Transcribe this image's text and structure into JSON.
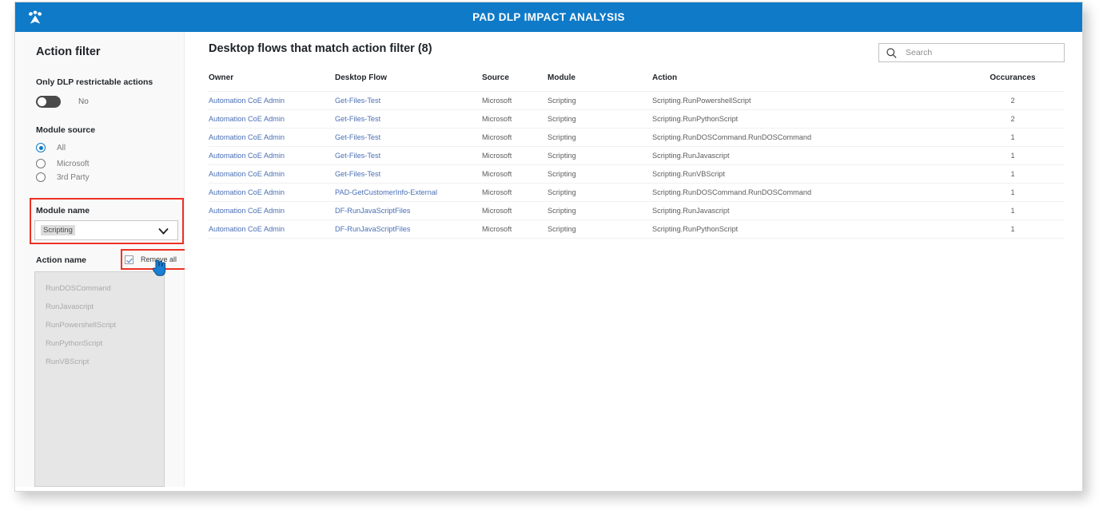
{
  "header": {
    "title": "PAD DLP IMPACT ANALYSIS",
    "logo_icon": "paw-print-icon",
    "background_color": "#0f7ac8"
  },
  "sidebar": {
    "title": "Action filter",
    "dlp_filter": {
      "label": "Only DLP restrictable actions",
      "toggle_value": "No",
      "toggle_on": false
    },
    "module_source": {
      "label": "Module source",
      "options": [
        {
          "label": "All",
          "selected": true
        },
        {
          "label": "Microsoft",
          "selected": false
        },
        {
          "label": "3rd Party",
          "selected": false
        }
      ]
    },
    "module_name": {
      "label": "Module name",
      "selected": "Scripting",
      "chevron_icon": "chevron-down-icon",
      "highlight_color": "#ee3124"
    },
    "action_name": {
      "label": "Action name",
      "remove_all_label": "Remove all",
      "remove_all_checked": true,
      "highlight_color": "#ee3124",
      "items": [
        "RunDOSCommand",
        "RunJavascript",
        "RunPowershellScript",
        "RunPythonScript",
        "RunVBScript"
      ]
    },
    "cursor_icon": "pointing-hand-cursor"
  },
  "main": {
    "title": "Desktop flows that match action filter (8)",
    "search": {
      "placeholder": "Search",
      "value": "",
      "icon": "search-icon"
    },
    "table": {
      "columns": [
        "Owner",
        "Desktop Flow",
        "Source",
        "Module",
        "Action",
        "Occurances"
      ],
      "rows": [
        {
          "owner": "Automation CoE Admin",
          "flow": "Get-Files-Test",
          "source": "Microsoft",
          "module": "Scripting",
          "action": "Scripting.RunPowershellScript",
          "occurances": "2"
        },
        {
          "owner": "Automation CoE Admin",
          "flow": "Get-Files-Test",
          "source": "Microsoft",
          "module": "Scripting",
          "action": "Scripting.RunPythonScript",
          "occurances": "2"
        },
        {
          "owner": "Automation CoE Admin",
          "flow": "Get-Files-Test",
          "source": "Microsoft",
          "module": "Scripting",
          "action": "Scripting.RunDOSCommand.RunDOSCommand",
          "occurances": "1"
        },
        {
          "owner": "Automation CoE Admin",
          "flow": "Get-Files-Test",
          "source": "Microsoft",
          "module": "Scripting",
          "action": "Scripting.RunJavascript",
          "occurances": "1"
        },
        {
          "owner": "Automation CoE Admin",
          "flow": "Get-Files-Test",
          "source": "Microsoft",
          "module": "Scripting",
          "action": "Scripting.RunVBScript",
          "occurances": "1"
        },
        {
          "owner": "Automation CoE Admin",
          "flow": "PAD-GetCustomerInfo-External",
          "source": "Microsoft",
          "module": "Scripting",
          "action": "Scripting.RunDOSCommand.RunDOSCommand",
          "occurances": "1"
        },
        {
          "owner": "Automation CoE Admin",
          "flow": "DF-RunJavaScriptFiles",
          "source": "Microsoft",
          "module": "Scripting",
          "action": "Scripting.RunJavascript",
          "occurances": "1"
        },
        {
          "owner": "Automation CoE Admin",
          "flow": "DF-RunJavaScriptFiles",
          "source": "Microsoft",
          "module": "Scripting",
          "action": "Scripting.RunPythonScript",
          "occurances": "1"
        }
      ]
    }
  }
}
